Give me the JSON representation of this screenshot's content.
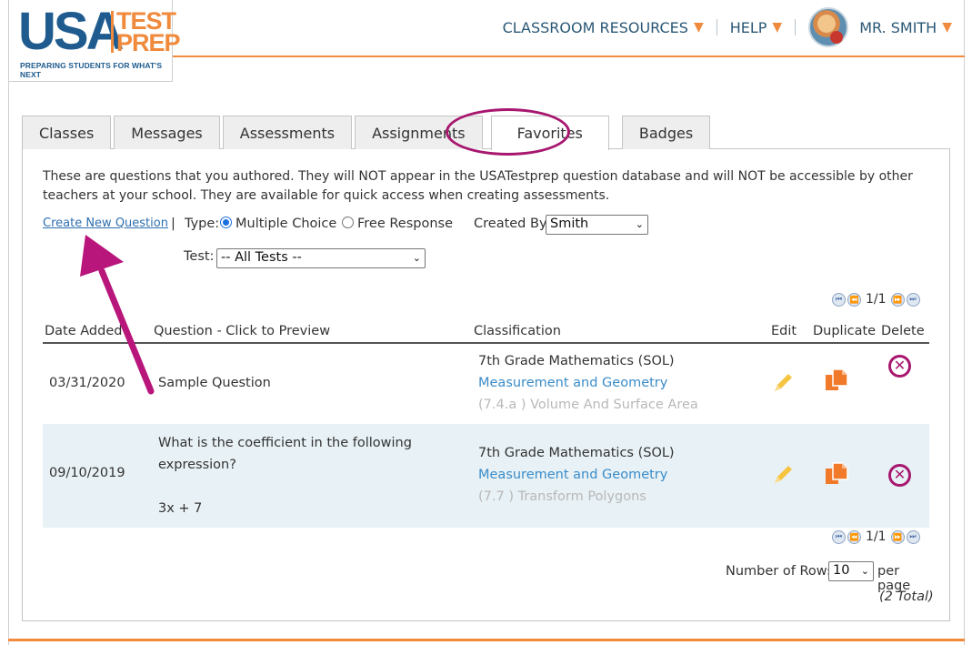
{
  "logo": {
    "usa": "USA",
    "test": "TEST",
    "prep": "PREP",
    "tagline": "PREPARING STUDENTS FOR WHAT'S NEXT"
  },
  "nav": {
    "classroom_resources": "CLASSROOM RESOURCES",
    "help": "HELP",
    "user": "MR. SMITH"
  },
  "tabs": [
    {
      "label": "Classes"
    },
    {
      "label": "Messages"
    },
    {
      "label": "Assessments"
    },
    {
      "label": "Assignments"
    },
    {
      "label": "Favorites"
    },
    {
      "label": "Badges"
    }
  ],
  "active_tab": "Favorites",
  "intro": "These are questions that you authored. They will NOT appear in the USATestprep question database and will NOT be accessible by other teachers at your school. They are available for quick access when creating assessments.",
  "controls": {
    "create_link": "Create New Question",
    "separator": "|",
    "type_label": "Type:",
    "type_options": [
      "Multiple Choice",
      "Free Response"
    ],
    "type_selected": "Multiple Choice",
    "created_by_label": "Created By:",
    "created_by_value": "Smith",
    "test_label": "Test:",
    "test_value": "-- All Tests --"
  },
  "pager": {
    "page": "1/1"
  },
  "table": {
    "headers": [
      "Date Added",
      "Question - Click to Preview",
      "Classification",
      "Edit",
      "Duplicate",
      "Delete"
    ],
    "rows": [
      {
        "date": "03/31/2020",
        "question_lines": [
          "Sample Question"
        ],
        "course": "7th Grade Mathematics (SOL)",
        "domain": "Measurement and Geometry",
        "standard": "(7.4.a ) Volume And Surface Area"
      },
      {
        "date": "09/10/2019",
        "question_lines": [
          "What is the coefficient in the following",
          "expression?",
          "",
          "3x + 7"
        ],
        "course": "7th Grade Mathematics (SOL)",
        "domain": "Measurement and Geometry",
        "standard": "(7.7 ) Transform Polygons"
      }
    ]
  },
  "footer": {
    "rows_label": "Number of Rows",
    "rows_value": "10",
    "per_page": "per page",
    "total": "(2 Total)"
  },
  "colors": {
    "brand_blue": "#1f5b8e",
    "brand_orange": "#f08a3c",
    "link_blue": "#3a8cc9",
    "annotation_magenta": "#a8176f",
    "edit_yellow": "#f5c542",
    "dup_orange": "#f07a2a"
  }
}
